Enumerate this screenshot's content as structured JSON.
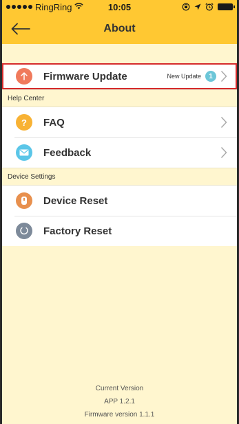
{
  "status_bar": {
    "carrier": "RingRing",
    "time": "10:05",
    "wifi_icon": "wifi-icon",
    "right_icons": [
      "rotation-lock-icon",
      "location-icon",
      "alarm-icon",
      "battery-icon"
    ]
  },
  "nav": {
    "title": "About",
    "back_icon": "arrow-left-icon"
  },
  "colors": {
    "header": "#ffc832",
    "background": "#fff6cf",
    "firmware_icon": "#f07a5c",
    "faq_icon": "#f8b234",
    "feedback_icon": "#5bc6e8",
    "device_reset_icon": "#e8904e",
    "factory_reset_icon": "#7d8a9a",
    "badge": "#6cc6d8",
    "highlight": "#d62b2b"
  },
  "firmware_row": {
    "label": "Firmware Update",
    "status_text": "New Update",
    "badge_count": "1"
  },
  "help_center": {
    "header": "Help Center",
    "items": [
      {
        "label": "FAQ",
        "icon": "question-icon"
      },
      {
        "label": "Feedback",
        "icon": "mail-icon"
      }
    ]
  },
  "device_settings": {
    "header": "Device Settings",
    "items": [
      {
        "label": "Device Reset",
        "icon": "device-icon"
      },
      {
        "label": "Factory Reset",
        "icon": "reset-icon"
      }
    ]
  },
  "footer": {
    "line1": "Current Version",
    "line2": "APP 1.2.1",
    "line3": "Firmware version  1.1.1"
  }
}
